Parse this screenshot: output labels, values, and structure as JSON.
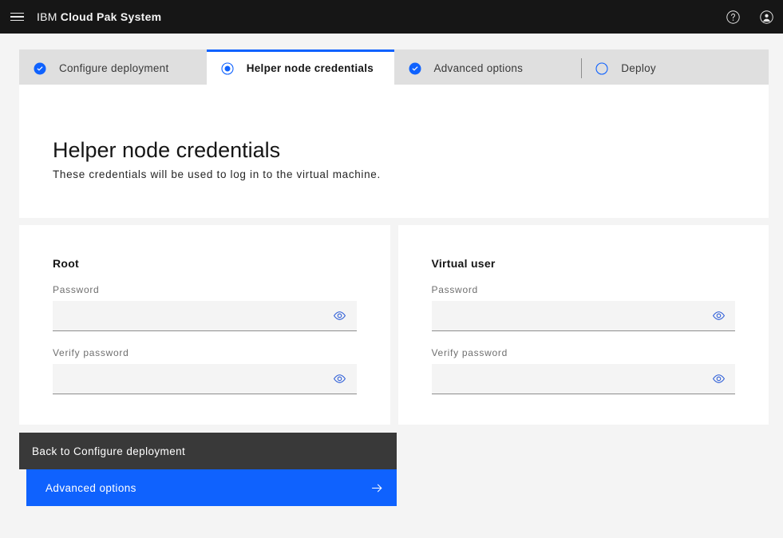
{
  "header": {
    "menu_icon": "hamburger-menu-icon",
    "brand": "IBM",
    "product": "Cloud Pak System",
    "help_icon": "help-circle-icon",
    "account_icon": "user-avatar-icon"
  },
  "steps": [
    {
      "label": "Configure deployment",
      "state": "complete",
      "icon": "check-circle-filled-icon"
    },
    {
      "label": "Helper node credentials",
      "state": "current",
      "icon": "radio-button-selected-icon"
    },
    {
      "label": "Advanced options",
      "state": "complete",
      "icon": "check-circle-filled-icon"
    },
    {
      "label": "Deploy",
      "state": "incomplete",
      "icon": "radio-button-unselected-icon"
    }
  ],
  "page": {
    "title": "Helper node credentials",
    "subtitle": "These credentials will be used to log in to the virtual machine."
  },
  "panels": [
    {
      "heading": "Root",
      "fields": [
        {
          "label": "Password",
          "value": "",
          "placeholder": "",
          "reveal_icon": "eye-icon"
        },
        {
          "label": "Verify password",
          "value": "",
          "placeholder": "",
          "reveal_icon": "eye-icon"
        }
      ]
    },
    {
      "heading": "Virtual user",
      "fields": [
        {
          "label": "Password",
          "value": "",
          "placeholder": "",
          "reveal_icon": "eye-icon"
        },
        {
          "label": "Verify password",
          "value": "",
          "placeholder": "",
          "reveal_icon": "eye-icon"
        }
      ]
    }
  ],
  "footer": {
    "back_label": "Back to Configure deployment",
    "next_label": "Advanced options",
    "next_icon": "arrow-right-icon"
  },
  "colors": {
    "brand_blue": "#0f62fe",
    "header_black": "#161616",
    "secondary_gray": "#393939",
    "field_bg": "#f4f4f4",
    "tab_inactive_bg": "#dfdfdf"
  }
}
